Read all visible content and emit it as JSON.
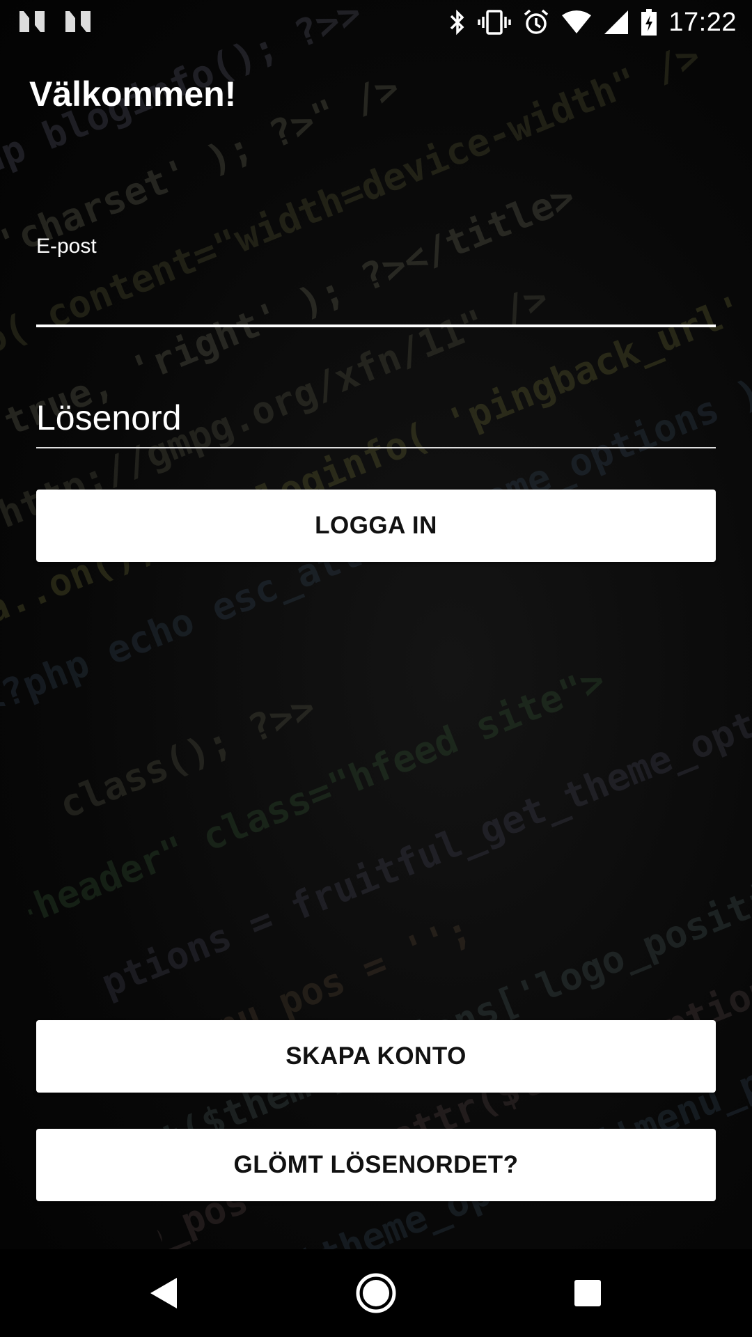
{
  "status_bar": {
    "time": "17:22",
    "left_icons": [
      "notification-n-icon",
      "notification-n-icon"
    ],
    "right_icons": [
      "bluetooth-icon",
      "vibrate-icon",
      "alarm-icon",
      "wifi-icon",
      "cell-signal-icon",
      "battery-charging-icon"
    ]
  },
  "header": {
    "title": "Välkommen!"
  },
  "form": {
    "email_label": "E-post",
    "email_value": "",
    "password_placeholder": "Lösenord",
    "login_label": "LOGGA IN"
  },
  "bottom_actions": {
    "create_account_label": "SKAPA KONTO",
    "forgot_password_label": "GLÖMT LÖSENORDET?"
  },
  "nav_bar": {
    "icons": [
      "back-icon",
      "home-icon",
      "recent-apps-icon"
    ]
  },
  "colors": {
    "background": "#000000",
    "text": "#ffffff",
    "button_bg": "#ffffff",
    "button_text": "#111111"
  }
}
